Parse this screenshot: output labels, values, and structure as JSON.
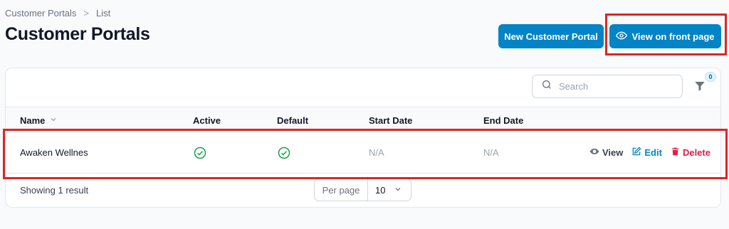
{
  "breadcrumb": {
    "items": [
      "Customer Portals",
      "List"
    ],
    "separator": ">"
  },
  "page": {
    "title": "Customer Portals"
  },
  "actions": {
    "new_label": "New Customer Portal",
    "front_label": "View on front page"
  },
  "search": {
    "placeholder": "Search"
  },
  "filter": {
    "count": "0"
  },
  "table": {
    "headers": {
      "name": "Name",
      "active": "Active",
      "default": "Default",
      "start": "Start Date",
      "end": "End Date"
    },
    "rows": [
      {
        "name": "Awaken Wellnes",
        "active": true,
        "default": true,
        "start_date": "N/A",
        "end_date": "N/A"
      }
    ],
    "row_actions": {
      "view": "View",
      "edit": "Edit",
      "delete": "Delete"
    }
  },
  "footer": {
    "summary": "Showing 1 result",
    "per_page_label": "Per page",
    "per_page_value": "10"
  },
  "colors": {
    "primary": "#0284c7",
    "success": "#16a34a",
    "danger": "#e11d48",
    "highlight": "#dc2626"
  }
}
